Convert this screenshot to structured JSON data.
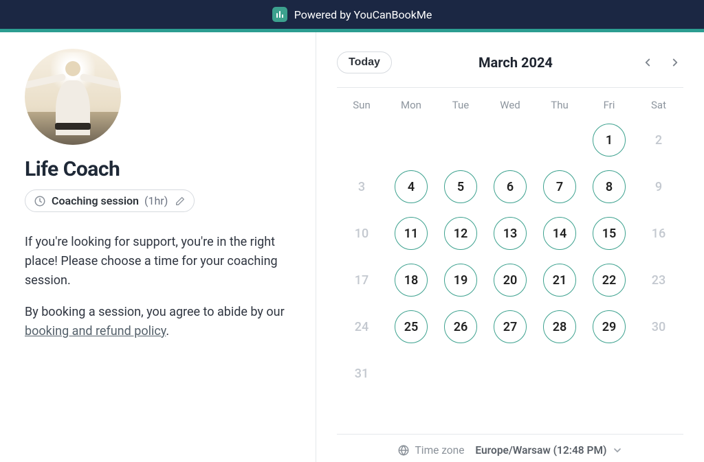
{
  "topbar": {
    "text": "Powered by YouCanBookMe"
  },
  "profile": {
    "title": "Life Coach",
    "session_label": "Coaching session",
    "session_duration": "(1hr)"
  },
  "description": {
    "p1": "If you're looking for support, you're in the right place! Please choose a time for your coaching session.",
    "p2_prefix": "By booking a session, you agree to abide by our ",
    "policy_link": "booking and refund policy",
    "p2_suffix": "."
  },
  "calendar": {
    "today_label": "Today",
    "month_label": "March 2024",
    "weekdays": [
      "Sun",
      "Mon",
      "Tue",
      "Wed",
      "Thu",
      "Fri",
      "Sat"
    ],
    "weeks": [
      [
        {
          "n": "",
          "s": "blank"
        },
        {
          "n": "",
          "s": "blank"
        },
        {
          "n": "",
          "s": "blank"
        },
        {
          "n": "",
          "s": "blank"
        },
        {
          "n": "",
          "s": "blank"
        },
        {
          "n": "1",
          "s": "available"
        },
        {
          "n": "2",
          "s": "disabled"
        }
      ],
      [
        {
          "n": "3",
          "s": "disabled"
        },
        {
          "n": "4",
          "s": "available"
        },
        {
          "n": "5",
          "s": "available"
        },
        {
          "n": "6",
          "s": "available"
        },
        {
          "n": "7",
          "s": "available"
        },
        {
          "n": "8",
          "s": "available"
        },
        {
          "n": "9",
          "s": "disabled"
        }
      ],
      [
        {
          "n": "10",
          "s": "disabled"
        },
        {
          "n": "11",
          "s": "available"
        },
        {
          "n": "12",
          "s": "available"
        },
        {
          "n": "13",
          "s": "available"
        },
        {
          "n": "14",
          "s": "available"
        },
        {
          "n": "15",
          "s": "available"
        },
        {
          "n": "16",
          "s": "disabled"
        }
      ],
      [
        {
          "n": "17",
          "s": "disabled"
        },
        {
          "n": "18",
          "s": "available"
        },
        {
          "n": "19",
          "s": "available"
        },
        {
          "n": "20",
          "s": "available"
        },
        {
          "n": "21",
          "s": "available"
        },
        {
          "n": "22",
          "s": "available"
        },
        {
          "n": "23",
          "s": "disabled"
        }
      ],
      [
        {
          "n": "24",
          "s": "disabled"
        },
        {
          "n": "25",
          "s": "available"
        },
        {
          "n": "26",
          "s": "available"
        },
        {
          "n": "27",
          "s": "available"
        },
        {
          "n": "28",
          "s": "available"
        },
        {
          "n": "29",
          "s": "available"
        },
        {
          "n": "30",
          "s": "disabled"
        }
      ],
      [
        {
          "n": "31",
          "s": "disabled"
        },
        {
          "n": "",
          "s": "blank"
        },
        {
          "n": "",
          "s": "blank"
        },
        {
          "n": "",
          "s": "blank"
        },
        {
          "n": "",
          "s": "blank"
        },
        {
          "n": "",
          "s": "blank"
        },
        {
          "n": "",
          "s": "blank"
        }
      ]
    ]
  },
  "timezone": {
    "label": "Time zone",
    "value": "Europe/Warsaw (12:48 PM)"
  }
}
